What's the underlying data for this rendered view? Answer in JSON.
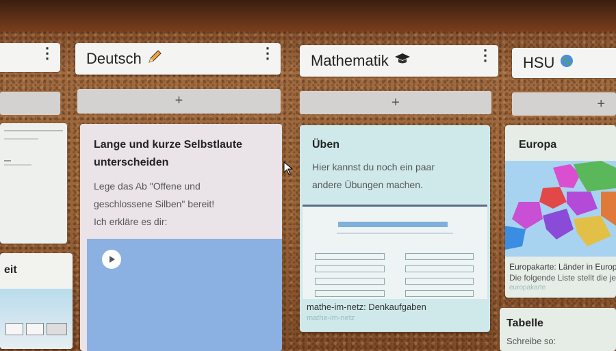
{
  "columns": {
    "left_partial": {
      "card1_title": "eit"
    },
    "deutsch": {
      "title": "Deutsch",
      "title_icon": "pencil-icon",
      "add_label": "+",
      "card": {
        "title": "Lange und kurze Selbstlaute unterscheiden",
        "lines": [
          "Lege das Ab \"Offene und",
          "geschlossene Silben\" bereit!",
          "Ich erkläre es dir:"
        ]
      }
    },
    "mathematik": {
      "title": "Mathematik",
      "title_icon": "graduation-cap-icon",
      "add_label": "+",
      "card": {
        "title": "Üben",
        "lines": [
          "Hier kannst du noch ein paar",
          "andere Übungen machen."
        ],
        "link_title": "mathe-im-netz: Denkaufgaben",
        "link_url": "mathe-im-netz"
      }
    },
    "hsu": {
      "title": "HSU",
      "title_icon": "globe-icon",
      "add_label": "+",
      "card1": {
        "title": "Europa",
        "caption_title": "Europakarte: Länder in Europa",
        "caption_text": "Die folgende Liste stellt die je",
        "caption_link": "europakarte"
      },
      "card2": {
        "title": "Tabelle",
        "text": "Schreibe so:"
      }
    }
  },
  "colors": {
    "deutsch_card_bg": "#eae3e8",
    "mathe_card_bg": "#cfe9ea",
    "hsu_card_bg": "#e6ede6",
    "video_blue": "#8bb0e2"
  }
}
